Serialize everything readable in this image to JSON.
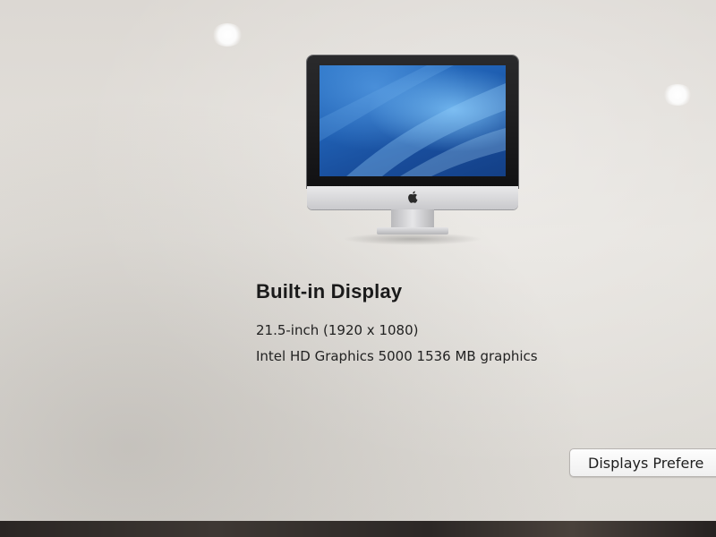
{
  "display": {
    "name": "Built-in Display",
    "size_resolution": "21.5-inch (1920 x 1080)",
    "graphics": "Intel HD Graphics 5000 1536 MB graphics"
  },
  "actions": {
    "preferences_button_label": "Displays Prefere"
  },
  "illustration": {
    "icon": "imac-icon",
    "logo_icon": "apple-logo-icon"
  },
  "colors": {
    "wallpaper_blue": "#1f5fb2",
    "background": "#e2dfda"
  }
}
